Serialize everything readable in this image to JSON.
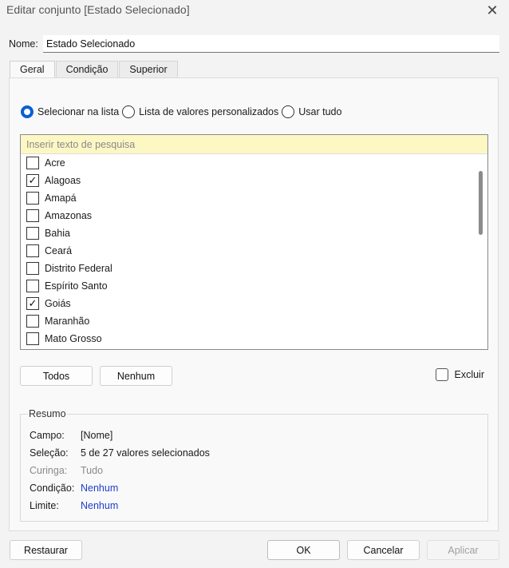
{
  "window": {
    "title": "Editar conjunto [Estado Selecionado]",
    "close_icon": "close-icon"
  },
  "name_field": {
    "label": "Nome:",
    "value": "Estado Selecionado"
  },
  "tabs": [
    {
      "label": "Geral",
      "active": true
    },
    {
      "label": "Condição",
      "active": false
    },
    {
      "label": "Superior",
      "active": false
    }
  ],
  "selection_mode": {
    "options": [
      {
        "label": "Selecionar na lista",
        "checked": true
      },
      {
        "label": "Lista de valores personalizados",
        "checked": false
      },
      {
        "label": "Usar tudo",
        "checked": false
      }
    ]
  },
  "search": {
    "placeholder": "Inserir texto de pesquisa",
    "value": ""
  },
  "list": {
    "items": [
      {
        "label": "Acre",
        "checked": false
      },
      {
        "label": "Alagoas",
        "checked": true
      },
      {
        "label": "Amapá",
        "checked": false
      },
      {
        "label": "Amazonas",
        "checked": false
      },
      {
        "label": "Bahia",
        "checked": false
      },
      {
        "label": "Ceará",
        "checked": false
      },
      {
        "label": "Distrito Federal",
        "checked": false
      },
      {
        "label": "Espírito Santo",
        "checked": false
      },
      {
        "label": "Goiás",
        "checked": true
      },
      {
        "label": "Maranhão",
        "checked": false
      },
      {
        "label": "Mato Grosso",
        "checked": false
      }
    ]
  },
  "list_buttons": {
    "all_label": "Todos",
    "none_label": "Nenhum"
  },
  "exclude": {
    "label": "Excluir",
    "checked": false
  },
  "summary": {
    "legend": "Resumo",
    "rows": [
      {
        "key": "Campo:",
        "value": "[Nome]",
        "style": "normal"
      },
      {
        "key": "Seleção:",
        "value": "5 de 27 valores selecionados",
        "style": "normal"
      },
      {
        "key": "Curinga:",
        "value": "Tudo",
        "style": "muted"
      },
      {
        "key": "Condição:",
        "value": "Nenhum",
        "style": "link"
      },
      {
        "key": "Limite:",
        "value": "Nenhum",
        "style": "link"
      }
    ]
  },
  "footer": {
    "restore_label": "Restaurar",
    "ok_label": "OK",
    "cancel_label": "Cancelar",
    "apply_label": "Aplicar"
  },
  "colors": {
    "accent": "#0b5ed7",
    "search_bg": "#fdf7c4",
    "link": "#1f3fc9",
    "disabled": "#a0a0a0"
  }
}
